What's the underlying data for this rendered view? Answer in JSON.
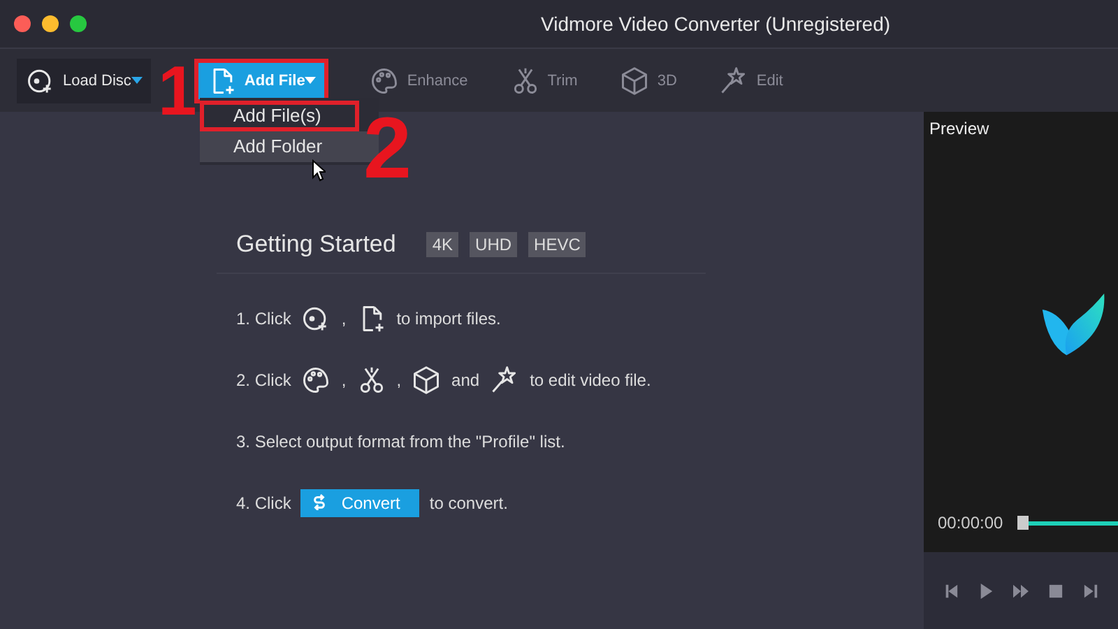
{
  "window": {
    "title": "Vidmore Video Converter (Unregistered)"
  },
  "toolbar": [
    {
      "label": "Load Disc",
      "kind": "load",
      "selected": false,
      "dropdown": true,
      "highlighted": false
    },
    {
      "label": "Add File",
      "kind": "file",
      "selected": true,
      "dropdown": true,
      "highlighted": true
    },
    {
      "label": "Enhance",
      "kind": "enhance",
      "selected": false,
      "dropdown": false,
      "highlighted": false
    },
    {
      "label": "Trim",
      "kind": "trim",
      "selected": false,
      "dropdown": false,
      "highlighted": false
    },
    {
      "label": "3D",
      "kind": "cube",
      "selected": false,
      "dropdown": false,
      "highlighted": false
    },
    {
      "label": "Edit",
      "kind": "edit",
      "selected": false,
      "dropdown": false,
      "highlighted": false
    }
  ],
  "menu": [
    {
      "label": "Add File(s)",
      "hovered": false,
      "highlighted": true
    },
    {
      "label": "Add Folder",
      "hovered": true,
      "highlighted": false
    }
  ],
  "annotations": [
    "1",
    "2"
  ],
  "getting_started": {
    "title": "Getting Started",
    "badges": [
      "4K",
      "UHD",
      "HEVC"
    ],
    "steps": [
      [
        {
          "kind": "text",
          "text": "1. Click"
        },
        {
          "kind": "load"
        },
        {
          "kind": "text",
          "text": ","
        },
        {
          "kind": "file"
        },
        {
          "kind": "text",
          "text": "to import files."
        }
      ],
      [
        {
          "kind": "text",
          "text": "2. Click"
        },
        {
          "kind": "enhance"
        },
        {
          "kind": "text",
          "text": ","
        },
        {
          "kind": "trim"
        },
        {
          "kind": "text",
          "text": ","
        },
        {
          "kind": "cube"
        },
        {
          "kind": "text",
          "text": "and"
        },
        {
          "kind": "edit"
        },
        {
          "kind": "text",
          "text": "to edit video file."
        }
      ],
      [
        {
          "kind": "text",
          "text": "3. Select output format from the \"Profile\" list."
        }
      ],
      [
        {
          "kind": "text",
          "text": "4. Click"
        },
        {
          "kind": "button",
          "text": "Convert"
        },
        {
          "kind": "text",
          "text": "to convert."
        }
      ]
    ]
  },
  "preview": {
    "title": "Preview",
    "time": "00:00:00"
  }
}
